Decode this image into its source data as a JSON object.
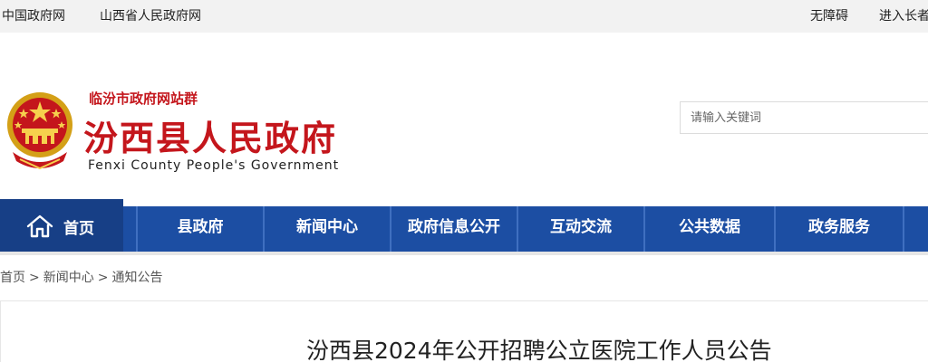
{
  "topbar": {
    "left_links": [
      "中国政府网",
      "山西省人民政府网"
    ],
    "right_links": [
      "无障碍",
      "进入长者"
    ]
  },
  "header": {
    "group_label": "临汾市政府网站群",
    "title": "汾西县人民政府",
    "title_en": "Fenxi County People's Government"
  },
  "search": {
    "placeholder": "请输入关键词"
  },
  "nav": {
    "home": "首页",
    "items": [
      "县政府",
      "新闻中心",
      "政府信息公开",
      "互动交流",
      "公共数据",
      "政务服务"
    ]
  },
  "breadcrumb": [
    "首页",
    "新闻中心",
    "通知公告"
  ],
  "breadcrumb_separator": ">",
  "article": {
    "title": "汾西县2024年公开招聘公立医院工作人员公告"
  },
  "colors": {
    "nav_bg": "#1c4ea3",
    "nav_active": "#173f86",
    "brand_red": "#c4161c"
  },
  "icons": {
    "home": "home-icon",
    "emblem": "national-emblem-icon"
  }
}
